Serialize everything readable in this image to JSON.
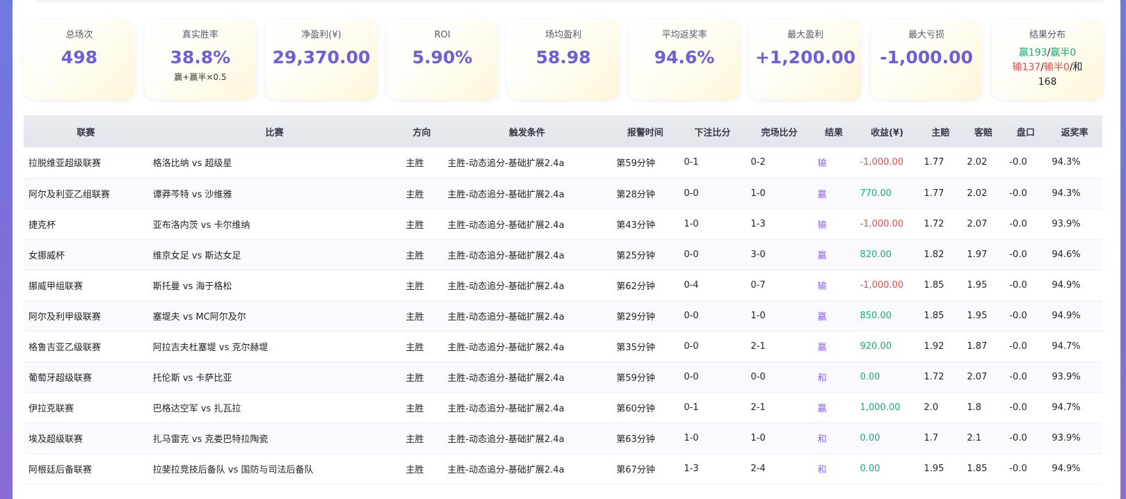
{
  "summary": {
    "total_label": "总场次",
    "total_value": "498",
    "winrate_label": "真实胜率",
    "winrate_value": "38.8%",
    "winrate_note": "赢+赢半×0.5",
    "net_label": "净盈利(¥)",
    "net_value": "29,370.00",
    "roi_label": "ROI",
    "roi_value": "5.90%",
    "avg_label": "场均盈利",
    "avg_value": "58.98",
    "return_label": "平均返奖率",
    "return_value": "94.6%",
    "maxwin_label": "最大盈利",
    "maxwin_value": "+1,200.00",
    "maxloss_label": "最大亏损",
    "maxloss_value": "-1,000.00",
    "dist_label": "结果分布",
    "dist": {
      "win": "赢193",
      "sep1": "/",
      "half_win": "赢半0",
      "lose": "输137",
      "sep2": "/",
      "half_lose": "输半0",
      "sep3": "/和",
      "draw": "168"
    }
  },
  "table": {
    "headers": [
      "联赛",
      "比赛",
      "方向",
      "触发条件",
      "报警时间",
      "下注比分",
      "完场比分",
      "结果",
      "收益(¥)",
      "主赔",
      "客赔",
      "盘口",
      "返奖率"
    ],
    "rows": [
      {
        "league": "拉脱维亚超级联赛",
        "match": "格洛比纳 vs 超级星",
        "dir": "主胜",
        "cond": "主胜-动态追分-基础扩展2.4a",
        "time": "第59分钟",
        "bet": "0-1",
        "final": "0-2",
        "result": "输",
        "profit": "-1,000.00",
        "sign": "neg",
        "home": "1.77",
        "away": "2.02",
        "line": "-0.0",
        "rr": "94.3%"
      },
      {
        "league": "阿尔及利亚乙组联赛",
        "match": "谭莽芩特 vs 沙维雅",
        "dir": "主胜",
        "cond": "主胜-动态追分-基础扩展2.4a",
        "time": "第28分钟",
        "bet": "0-0",
        "final": "1-0",
        "result": "赢",
        "profit": "770.00",
        "sign": "pos",
        "home": "1.77",
        "away": "2.02",
        "line": "-0.0",
        "rr": "94.3%"
      },
      {
        "league": "捷克杯",
        "match": "亚布洛内茨 vs 卡尔维纳",
        "dir": "主胜",
        "cond": "主胜-动态追分-基础扩展2.4a",
        "time": "第43分钟",
        "bet": "1-0",
        "final": "1-3",
        "result": "输",
        "profit": "-1,000.00",
        "sign": "neg",
        "home": "1.72",
        "away": "2.07",
        "line": "-0.0",
        "rr": "93.9%"
      },
      {
        "league": "女挪威杯",
        "match": "维京女足 vs 斯达女足",
        "dir": "主胜",
        "cond": "主胜-动态追分-基础扩展2.4a",
        "time": "第25分钟",
        "bet": "0-0",
        "final": "3-0",
        "result": "赢",
        "profit": "820.00",
        "sign": "pos",
        "home": "1.82",
        "away": "1.97",
        "line": "-0.0",
        "rr": "94.6%"
      },
      {
        "league": "挪威甲组联赛",
        "match": "斯托曼 vs 海于格松",
        "dir": "主胜",
        "cond": "主胜-动态追分-基础扩展2.4a",
        "time": "第62分钟",
        "bet": "0-4",
        "final": "0-7",
        "result": "输",
        "profit": "-1,000.00",
        "sign": "neg",
        "home": "1.85",
        "away": "1.95",
        "line": "-0.0",
        "rr": "94.9%"
      },
      {
        "league": "阿尔及利甲级联赛",
        "match": "塞堤夫 vs MC阿尔及尔",
        "dir": "主胜",
        "cond": "主胜-动态追分-基础扩展2.4a",
        "time": "第29分钟",
        "bet": "0-0",
        "final": "1-0",
        "result": "赢",
        "profit": "850.00",
        "sign": "pos",
        "home": "1.85",
        "away": "1.95",
        "line": "-0.0",
        "rr": "94.9%"
      },
      {
        "league": "格鲁吉亚乙级联赛",
        "match": "阿拉吉夫杜塞堤 vs 克尔赫堤",
        "dir": "主胜",
        "cond": "主胜-动态追分-基础扩展2.4a",
        "time": "第35分钟",
        "bet": "0-0",
        "final": "2-1",
        "result": "赢",
        "profit": "920.00",
        "sign": "pos",
        "home": "1.92",
        "away": "1.87",
        "line": "-0.0",
        "rr": "94.7%"
      },
      {
        "league": "葡萄牙超级联赛",
        "match": "托伦斯 vs 卡萨比亚",
        "dir": "主胜",
        "cond": "主胜-动态追分-基础扩展2.4a",
        "time": "第59分钟",
        "bet": "0-0",
        "final": "0-0",
        "result": "和",
        "profit": "0.00",
        "sign": "zero",
        "home": "1.72",
        "away": "2.07",
        "line": "-0.0",
        "rr": "93.9%"
      },
      {
        "league": "伊拉克联赛",
        "match": "巴格达空军 vs 扎瓦拉",
        "dir": "主胜",
        "cond": "主胜-动态追分-基础扩展2.4a",
        "time": "第60分钟",
        "bet": "0-1",
        "final": "2-1",
        "result": "赢",
        "profit": "1,000.00",
        "sign": "pos",
        "home": "2.0",
        "away": "1.8",
        "line": "-0.0",
        "rr": "94.7%"
      },
      {
        "league": "埃及超级联赛",
        "match": "扎马雷克 vs 克娄巴特拉陶瓷",
        "dir": "主胜",
        "cond": "主胜-动态追分-基础扩展2.4a",
        "time": "第63分钟",
        "bet": "1-0",
        "final": "1-0",
        "result": "和",
        "profit": "0.00",
        "sign": "zero",
        "home": "1.7",
        "away": "2.1",
        "line": "-0.0",
        "rr": "93.9%"
      },
      {
        "league": "阿根廷后备联赛",
        "match": "拉斐拉竞技后备队 vs 国防与司法后备队",
        "dir": "主胜",
        "cond": "主胜-动态追分-基础扩展2.4a",
        "time": "第67分钟",
        "bet": "1-3",
        "final": "2-4",
        "result": "和",
        "profit": "0.00",
        "sign": "zero",
        "home": "1.95",
        "away": "1.85",
        "line": "-0.0",
        "rr": "94.9%"
      }
    ]
  }
}
